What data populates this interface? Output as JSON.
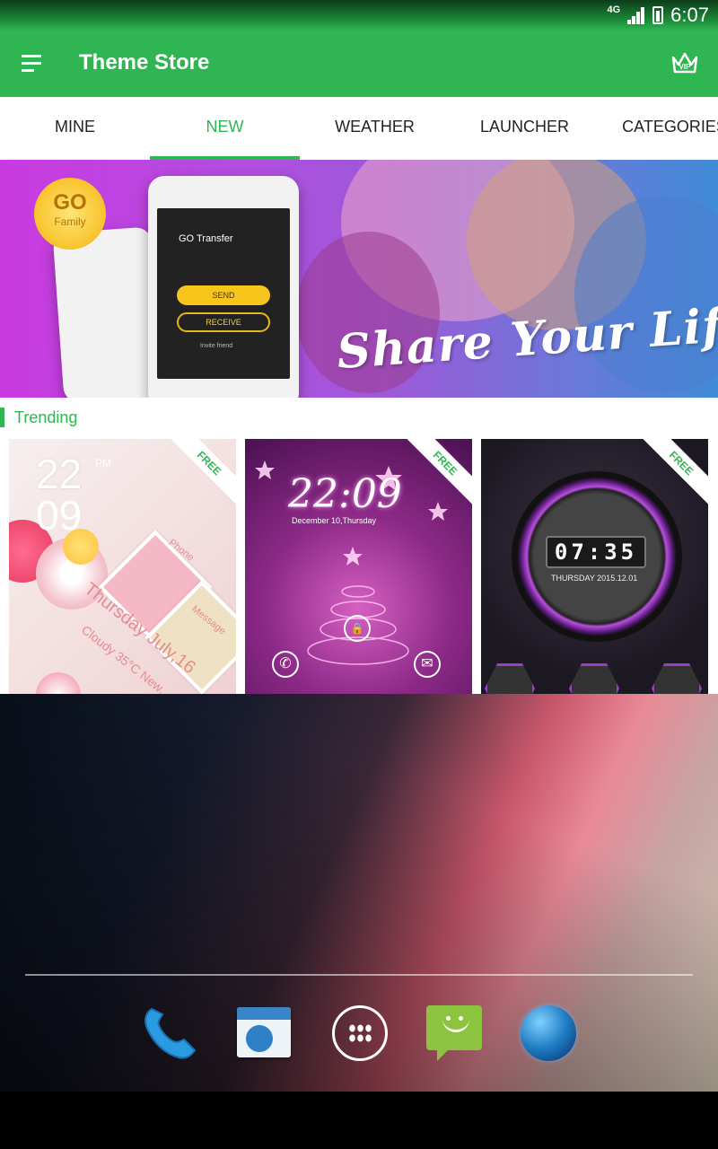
{
  "status_bar": {
    "network": "4G",
    "time": "6:07"
  },
  "app_bar": {
    "title": "Theme Store",
    "vip_label": "VIP"
  },
  "tabs": [
    {
      "label": "MINE",
      "active": false
    },
    {
      "label": "NEW",
      "active": true
    },
    {
      "label": "WEATHER",
      "active": false
    },
    {
      "label": "LAUNCHER",
      "active": false
    },
    {
      "label": "CATEGORIES",
      "active": false
    }
  ],
  "banner": {
    "medal_title": "GO",
    "medal_subtitle": "Family",
    "app_title": "GO Transfer",
    "send_label": "SEND",
    "receive_label": "RECEIVE",
    "invite_label": "Invite friend",
    "tagline": "Share Your Life"
  },
  "trending": {
    "title": "Trending",
    "free_label": "FREE",
    "card1": {
      "hour": "22",
      "minute": "09",
      "ampm": "PM",
      "date": "Thursday July,16",
      "weather": "Cloudy 35°C New...",
      "phone_label": "Phone",
      "message_label": "Message"
    },
    "card2": {
      "time": "22:09",
      "date": "December 10,Thursday"
    },
    "card3": {
      "time": "07:35",
      "date": "THURSDAY  2015.12.01"
    }
  },
  "colors": {
    "accent": "#2fb552",
    "tab_text": "#222222",
    "background": "#ffffff"
  },
  "icons": [
    "menu-icon",
    "vip-crown-icon",
    "phone-icon",
    "contacts-icon",
    "apps-drawer-icon",
    "messaging-icon",
    "browser-globe-icon"
  ]
}
